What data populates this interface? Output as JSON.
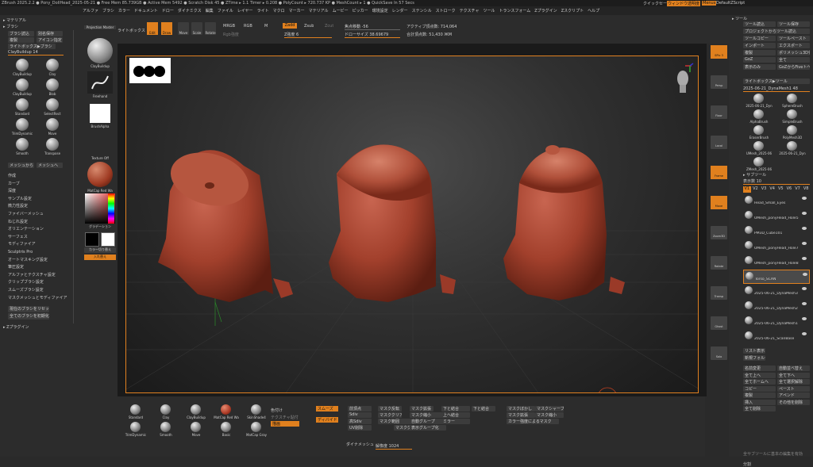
{
  "titlebar": {
    "segments": [
      "ZBrush 2025.2.2",
      "Pony_DollHead_2025-05-21",
      "Free Mem 85.739GB",
      "Active Mem 5492",
      "Scratch Disk 45",
      "ZTime ▸ 1.1 Timer ▸ 0.208",
      "PolyCount ▸ 720.737 KP",
      "MeshCount ▸ 1",
      "QuickSave In 57 Secs"
    ],
    "right_items": [
      "クイックセーブ",
      "ウィンドウ透明度",
      "Menus",
      "DefaultZScript"
    ]
  },
  "menubar": {
    "items": [
      "アルファ",
      "ブラシ",
      "カラー",
      "ドキュメント",
      "ドロー",
      "ダイナミクス",
      "編集",
      "ファイル",
      "レイヤー",
      "ライト",
      "マクロ",
      "マーカー",
      "マテリアル",
      "ムービー",
      "ピッカー",
      "環境設定",
      "レンダー",
      "ステンシル",
      "ストローク",
      "テクスチャ",
      "ツール",
      "トランスフォーム",
      "Zプラグイン",
      "Zスクリプト",
      "ヘルプ"
    ]
  },
  "left_panel": {
    "material_title": "マテリアル",
    "brush_title": "ブラシ",
    "brush_buttons": [
      "ブラシ読込",
      "別名保存",
      "複製",
      "アイコン指定",
      "ライトボックス▶ブラシ"
    ],
    "brush_slider": "ClayBuildup 14",
    "brushes": [
      "ClayBuildup",
      "Clay",
      "ClayBuildup",
      "Blob",
      "Standard",
      "SelectRect",
      "TrimDynamic",
      "Move",
      "Smooth",
      "Transpose"
    ],
    "brush_buttons2": [
      "メッシュから",
      "メッシュへ"
    ],
    "menu_items": [
      "作成",
      "カーブ",
      "深度",
      "サンプル設定",
      "微力性設定",
      "ファイバーメッシュ",
      "ねじれ設定",
      "オリエンテーション",
      "サーフェス",
      "モディファイア",
      "Sculptris Pro",
      "オートマスキング設定",
      "筆圧設定",
      "アルファとテクスチャ設定",
      "クリップブラシ設定",
      "スムーズブラシ設定",
      "マスクメッシュとモディファイア"
    ],
    "reset_buttons": [
      "現在のブラシをリセット",
      "全てのブラシを初期化"
    ],
    "zplugin_title": "Zプラグイン"
  },
  "shelf": {
    "items": [
      "Projection Master",
      "ClayBuildup",
      "Freehand",
      "BrushAlpha",
      "Texture Off",
      "MatCap Red Wa",
      "グラデーション",
      "カラー切り替え",
      "入れ替え"
    ]
  },
  "top_bar": {
    "lightbox": "ライトボックス",
    "buttons": [
      "Edit",
      "Draw",
      "Move",
      "Scale",
      "Rotate"
    ],
    "rgb_labels": [
      "MRGB",
      "RGB",
      "M"
    ],
    "zadd": "Zadd",
    "zsub": "Zsub",
    "zcut": "Zcut",
    "rgb_intensity": "Rgb強度",
    "z_intensity": "Z強度 6",
    "focal_shift": "焦点移動 -56",
    "draw_size": "ドローサイズ 38.69679",
    "active_points": "アクティブ頂点数: 714,064",
    "total_points": "合計頂点数: 51,430 ЖM"
  },
  "right_panel": {
    "tool_title": "ツール",
    "tool_buttons": [
      "ツール読込",
      "ツール保存",
      "プロジェクトからツール読込",
      "ツールコピー",
      "ツールペースト",
      "インポート",
      "エクスポート",
      "複製",
      "ポリメッシュ3D化",
      "GoZ",
      "全て",
      "表示のみ",
      "GoZからFiveトへ",
      "ライトボックス▶ツール"
    ],
    "current_tool": "2025-06-21_DynaMesh1 48",
    "tools": [
      "2025-06-21_Dyn",
      "SphereBrush",
      "AlphaBrush",
      "SimpleBrush",
      "EraserBrush",
      "PolyMesh3D",
      "UMesh_2025-06",
      "2025-06-21_Dyn",
      "ZMesh_2025-06"
    ],
    "subtool_title": "サブツール",
    "visible_count": "表示数 10",
    "v_tabs": [
      "V1",
      "V2",
      "V3",
      "V4",
      "V5",
      "V6",
      "V7",
      "V8"
    ],
    "subtools": [
      "Head_Small_Eyes",
      "UMesh_ponyHead_Hole5",
      "PM3D_Cube101",
      "UMesh_ponyHead_Hole7",
      "UMesh_ponyHead_Hole8",
      "Torso_SCAN",
      "2025-06-21_DynaMesh3",
      "2025-06-21_DynaMesh2",
      "2025-06-21_DynaMesh1",
      "2025-06-21_ScanBase"
    ],
    "list_buttons": [
      "リスト表示",
      "新規フォルダ"
    ],
    "action_buttons": [
      "名前変更",
      "自動並べ替え",
      "全て上へ",
      "全て下へ",
      "全てホームへ",
      "全て選択解除",
      "コピー",
      "ペースト",
      "複製",
      "アペンド",
      "挿入",
      "その他を削除",
      "全て削除"
    ],
    "footer": "全サブツールに基本の編集を有効",
    "footer2": "分割"
  },
  "right_strip": {
    "labels": [
      "SPix 3",
      "Persp",
      "Floor",
      "Local",
      "Frame",
      "Move",
      "Zoom3D",
      "Rotate",
      "Transp",
      "Ghost",
      "Solo"
    ]
  },
  "bottom_shelf": {
    "materials": [
      "Standard",
      "Clay",
      "ClayBuildup",
      "MatCap Red Wa",
      "SkinShade4",
      "TrimDynamic",
      "Smooth",
      "Move",
      "Basic",
      "MatCap Gray"
    ],
    "color_label": "色付け",
    "texture_label": "テクスチャ貼付",
    "draw_label": "描画",
    "toggles": [
      "スムーズ",
      "ディバイド",
      "前頂点",
      "Sdiv",
      "高Sdiv",
      "UV削除",
      "マスク反転",
      "マスククリア",
      "マスク範囲",
      "マスクグループ",
      "マスク拡張",
      "マスク縮小",
      "自動グループ",
      "表示グループ化",
      "下と結合",
      "上へ結合",
      "下と結合",
      "マスクぼかし",
      "マスクシャープ",
      "マスク拡張",
      "マスク縮小",
      "カラー強度によるマスク",
      "ミラー",
      "カラー強度によるマスク"
    ],
    "dynamesh": "ダイナメッシュ",
    "resolution": "解像度 1024"
  },
  "colors": {
    "accent": "#e0801e",
    "bg": "#2c2c2c",
    "clay": "#b5503a"
  }
}
